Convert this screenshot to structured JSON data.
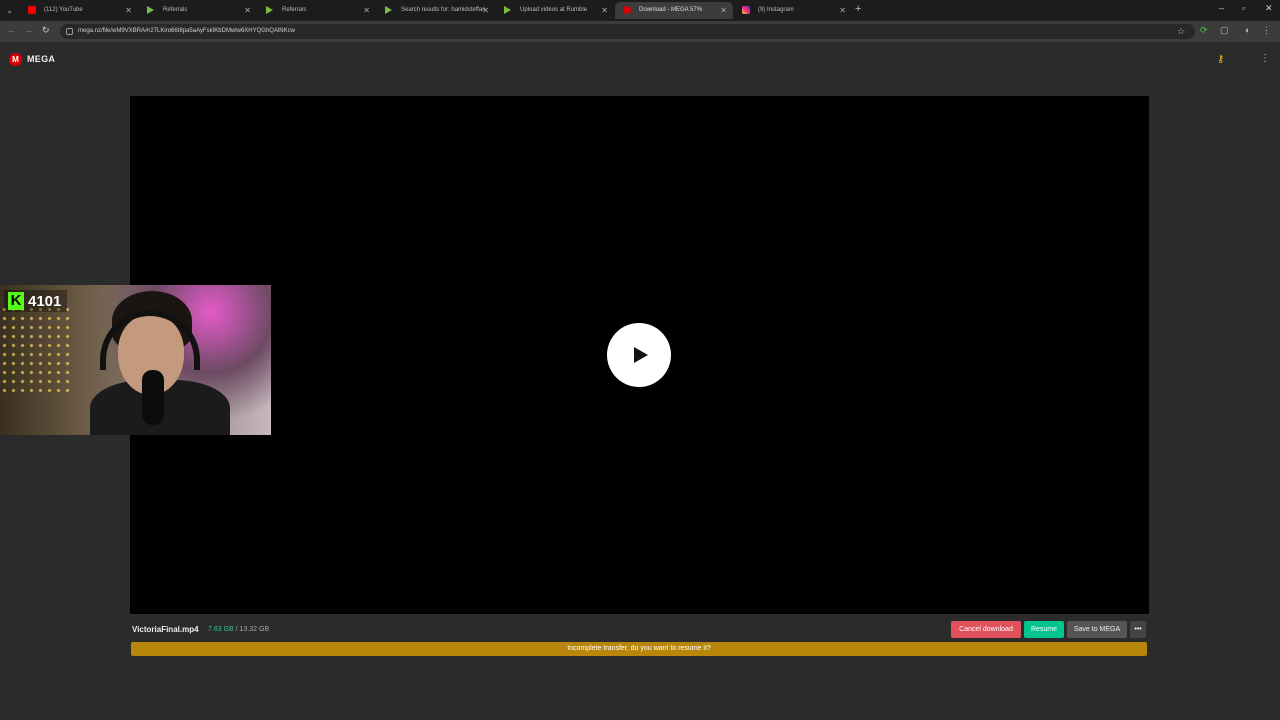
{
  "browser": {
    "tabs": [
      {
        "title": "(112) YouTube",
        "favicon": "youtube-icon"
      },
      {
        "title": "Referrals",
        "favicon": "rumble-icon"
      },
      {
        "title": "Referrals",
        "favicon": "rumble-icon"
      },
      {
        "title": "Search results for: hamidsteffan",
        "favicon": "rumble-icon"
      },
      {
        "title": "Upload videos at Rumble",
        "favicon": "rumble-icon"
      },
      {
        "title": "Download - MEGA 57%",
        "favicon": "mega-icon"
      },
      {
        "title": "(9) Instagram",
        "favicon": "instagram-icon"
      }
    ],
    "active_tab": 5,
    "url": "mega.nz/file/wM9VXBRA#r27LKiro66I8pa5aAyFskIKbDMwlw6XHYQGhQAlNKcw"
  },
  "header": {
    "logo_letter": "M",
    "brand": "MEGA"
  },
  "webcam": {
    "kick_letter": "K",
    "viewer_count": "4101"
  },
  "file": {
    "name": "VictoriaFinal.mp4",
    "downloaded": "7.63 GB",
    "separator": "/",
    "total": "13.32 GB"
  },
  "actions": {
    "cancel_label": "Cancel download",
    "resume_label": "Resume",
    "save_label": "Save to MEGA",
    "more_label": "•••"
  },
  "banner": {
    "message": "Incomplete transfer, do you want to resume it?"
  },
  "colors": {
    "mega_red": "#d90007",
    "resume_green": "#00c58e",
    "cancel_red": "#e1525d",
    "banner_gold": "#b8860b",
    "kick_green": "#53fc18"
  }
}
